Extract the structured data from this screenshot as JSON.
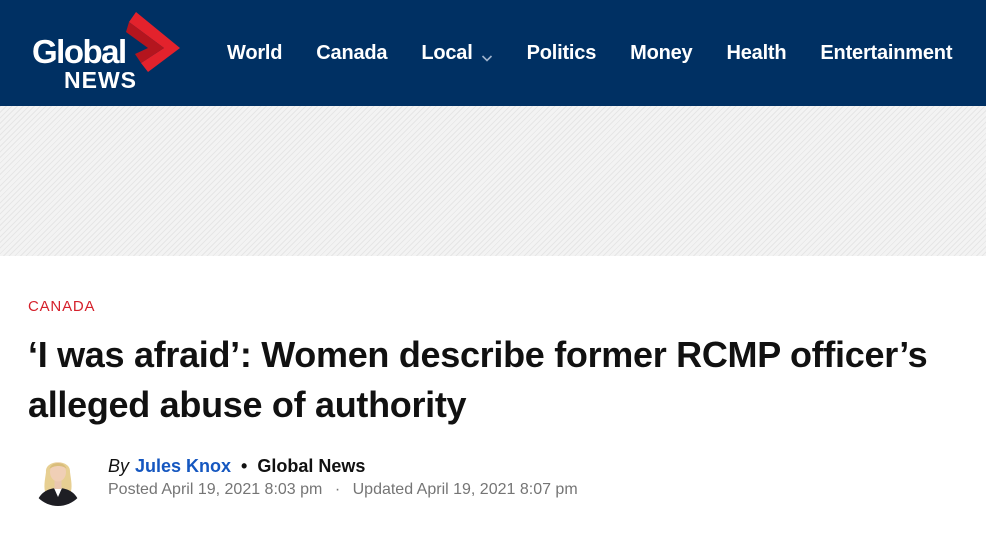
{
  "brand": {
    "name_line1": "Global",
    "name_line2": "NEWS",
    "colors": {
      "header_bg": "#003063",
      "accent_red": "#e3222c",
      "link_blue": "#1557c0"
    }
  },
  "nav": {
    "items": [
      {
        "label": "World",
        "has_dropdown": false
      },
      {
        "label": "Canada",
        "has_dropdown": false
      },
      {
        "label": "Local",
        "has_dropdown": true,
        "icon": "chevron-down-icon"
      },
      {
        "label": "Politics",
        "has_dropdown": false
      },
      {
        "label": "Money",
        "has_dropdown": false
      },
      {
        "label": "Health",
        "has_dropdown": false
      },
      {
        "label": "Entertainment",
        "has_dropdown": false
      }
    ]
  },
  "article": {
    "category": "CANADA",
    "headline": "‘I was afraid’: Women describe former RCMP officer’s alleged abuse of authority",
    "byline": {
      "by_label": "By",
      "author": "Jules Knox",
      "separator": "•",
      "source": "Global News",
      "posted": "Posted April 19, 2021 8:03 pm",
      "meta_separator": "·",
      "updated": "Updated April 19, 2021 8:07 pm"
    }
  }
}
